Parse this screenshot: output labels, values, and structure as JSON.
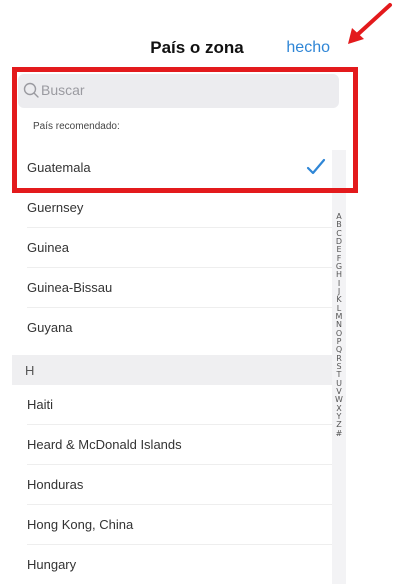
{
  "header": {
    "title": "País o zona",
    "done_label": "hecho"
  },
  "search": {
    "placeholder": "Buscar",
    "icon": "search-icon"
  },
  "recommended": {
    "label": "País recomendado:",
    "country": "Guatemala",
    "selected": true
  },
  "rows_top": [
    {
      "name": "Guernsey"
    },
    {
      "name": "Guinea"
    },
    {
      "name": "Guinea-Bissau"
    },
    {
      "name": "Guyana"
    }
  ],
  "section_h": {
    "letter": "H"
  },
  "rows_h": [
    {
      "name": "Haiti"
    },
    {
      "name": "Heard & McDonald Islands"
    },
    {
      "name": "Honduras"
    },
    {
      "name": "Hong Kong, China"
    },
    {
      "name": "Hungary"
    }
  ],
  "index_letters": [
    "A",
    "B",
    "C",
    "D",
    "E",
    "F",
    "G",
    "H",
    "I",
    "J",
    "K",
    "L",
    "M",
    "N",
    "O",
    "P",
    "Q",
    "R",
    "S",
    "T",
    "U",
    "V",
    "W",
    "X",
    "Y",
    "Z",
    "#"
  ],
  "colors": {
    "accent": "#2f86d6",
    "highlight": "#e31a1c",
    "arrow": "#e31a1c",
    "check": "#2f86d6"
  }
}
